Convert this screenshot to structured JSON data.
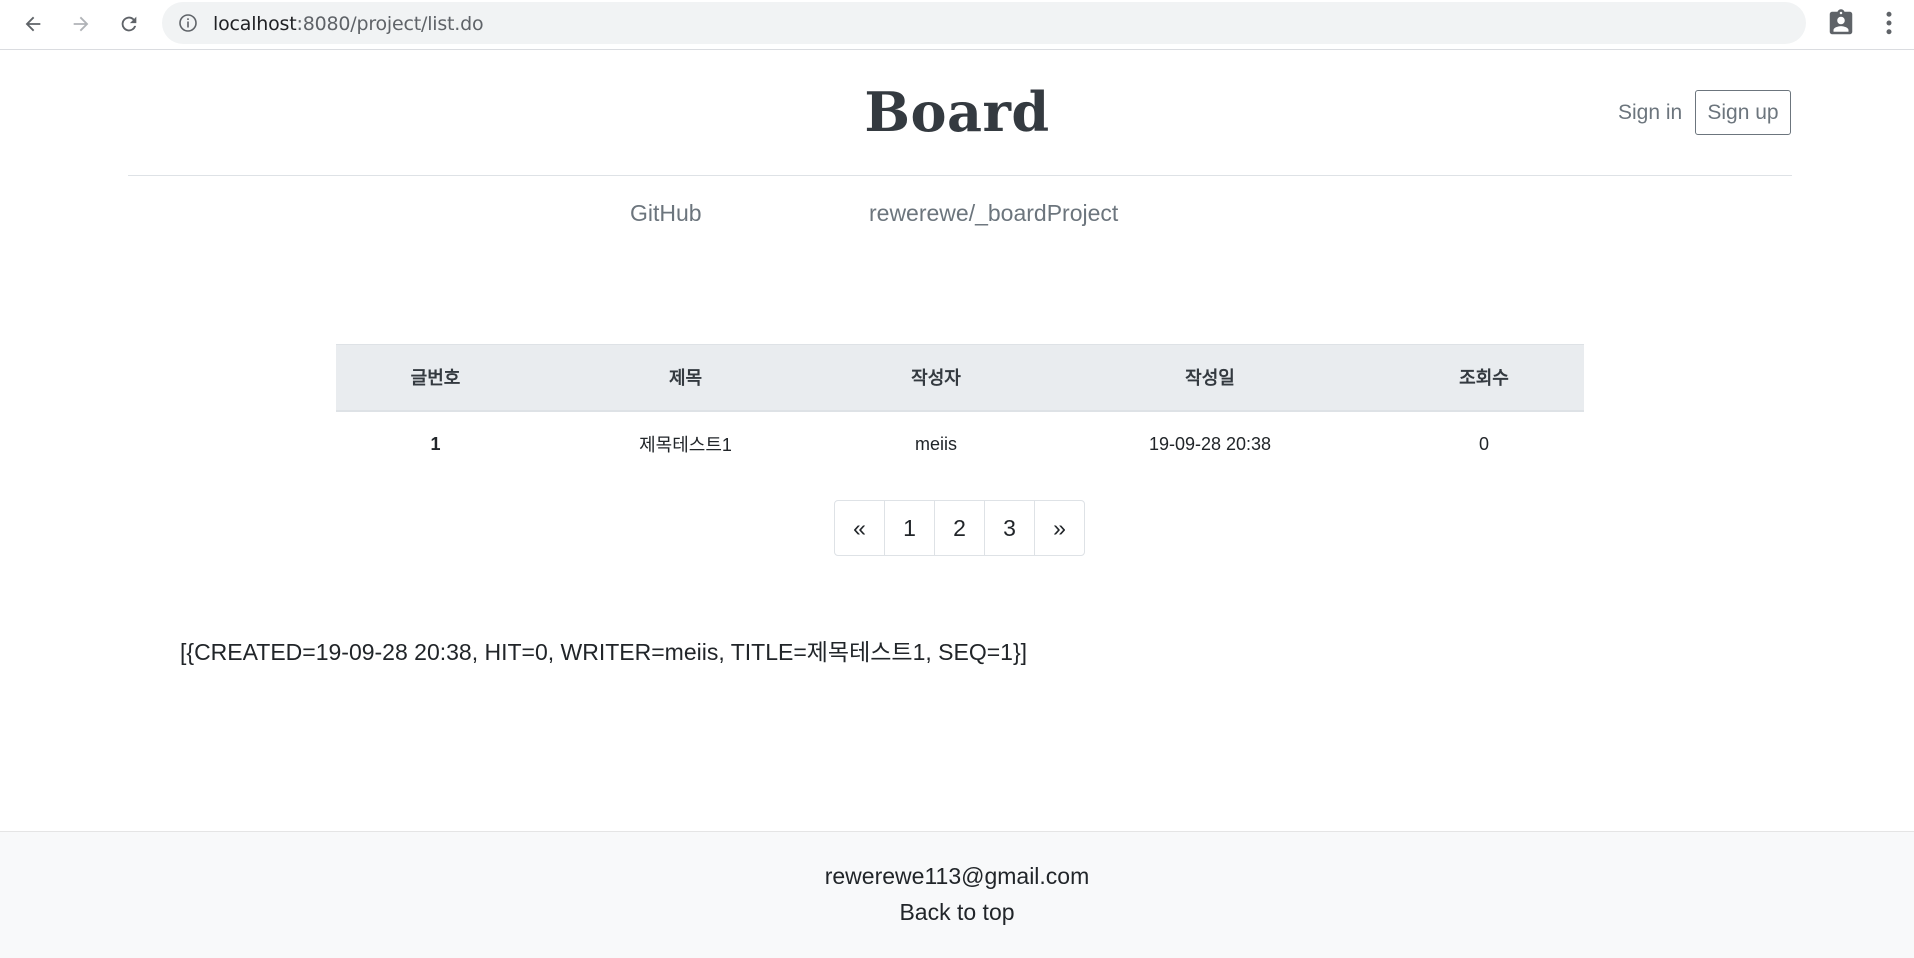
{
  "browser": {
    "url_host": "localhost",
    "url_path": ":8080/project/list.do"
  },
  "header": {
    "brand": "Board",
    "sign_in": "Sign in",
    "sign_up": "Sign up"
  },
  "nav": {
    "github": "GitHub",
    "repo": "rewerewe/_boardProject"
  },
  "table": {
    "columns": [
      "글번호",
      "제목",
      "작성자",
      "작성일",
      "조회수"
    ],
    "rows": [
      {
        "seq": "1",
        "title": "제목테스트1",
        "writer": "meiis",
        "created": "19-09-28 20:38",
        "hit": "0"
      }
    ]
  },
  "pagination": {
    "prev": "«",
    "pages": [
      "1",
      "2",
      "3"
    ],
    "next": "»"
  },
  "dump_text": "[{CREATED=19-09-28 20:38, HIT=0, WRITER=meiis, TITLE=제목테스트1, SEQ=1}]",
  "footer": {
    "email": "rewerewe113@gmail.com",
    "back_to_top": "Back to top"
  }
}
